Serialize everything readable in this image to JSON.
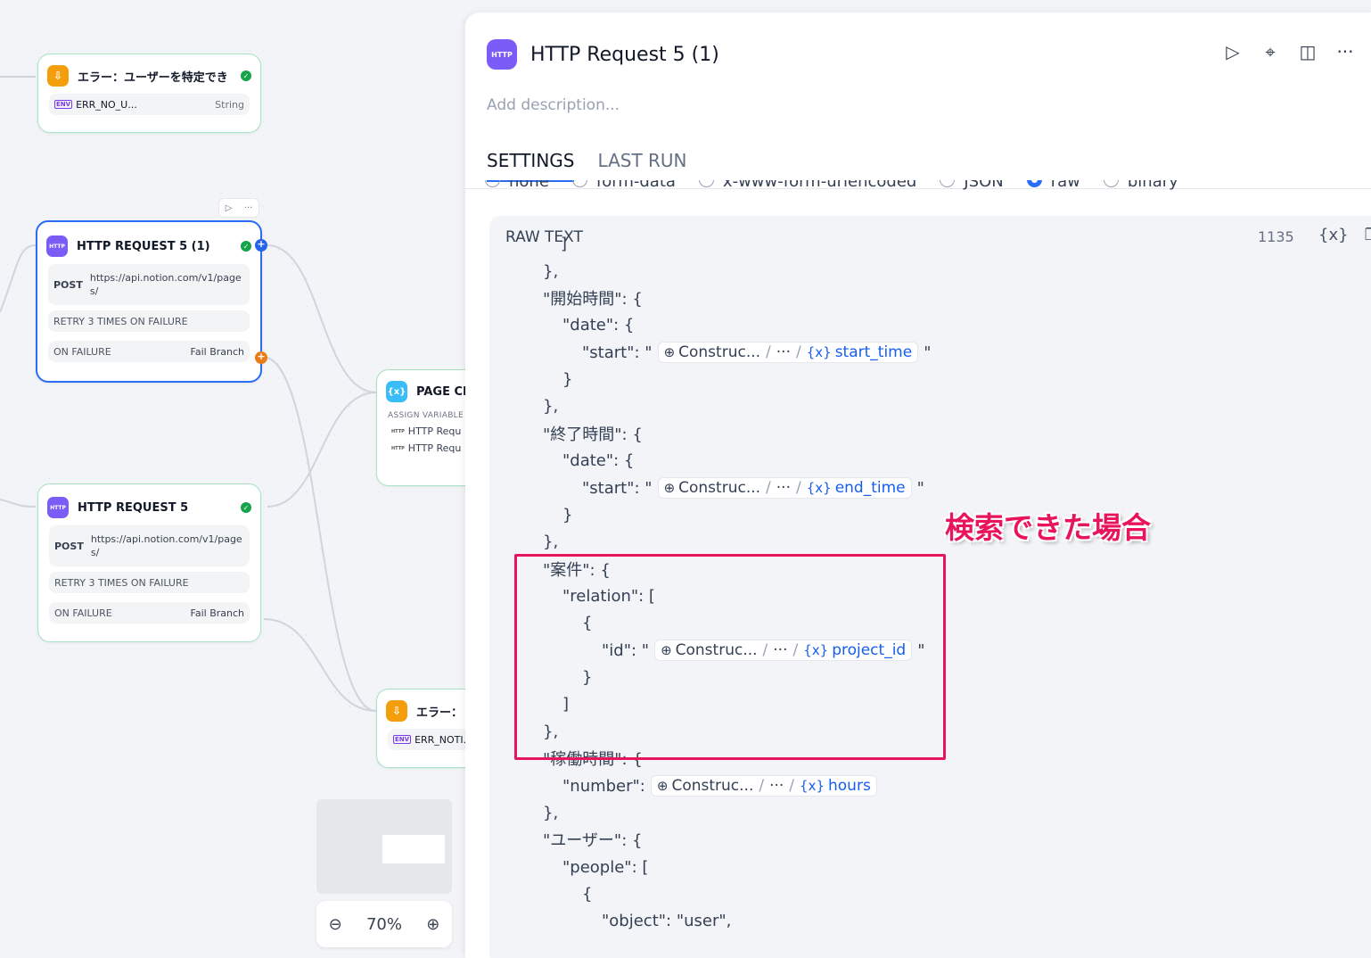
{
  "canvas": {
    "nodes": {
      "error_user": {
        "title": "エラー：ユーザーを特定でき",
        "env_label": "ENV",
        "var_name": "ERR_NO_U...",
        "var_type": "String"
      },
      "http5_1": {
        "icon_label": "HTTP",
        "title": "HTTP REQUEST 5 (1)",
        "method": "POST",
        "url": "https://api.notion.com/v1/pages/",
        "retry": "RETRY 3 TIMES ON FAILURE",
        "on_failure": "ON FAILURE",
        "fail_branch": "Fail Branch"
      },
      "page_cr": {
        "icon_label": "{x}",
        "title": "PAGE CR",
        "assign_label": "ASSIGN VARIABLE",
        "vars": [
          "HTTP Requ",
          "HTTP Requ"
        ]
      },
      "http5": {
        "icon_label": "HTTP",
        "title": "HTTP REQUEST 5",
        "method": "POST",
        "url": "https://api.notion.com/v1/pages/",
        "retry": "RETRY 3 TIMES ON FAILURE",
        "on_failure": "ON FAILURE",
        "fail_branch": "Fail Branch"
      },
      "error_noti": {
        "title": "エラー：",
        "env_label": "ENV",
        "var_name": "ERR_NOTI..."
      }
    },
    "zoom": {
      "level": "70%"
    }
  },
  "panel": {
    "icon_label": "HTTP",
    "title": "HTTP Request 5 (1)",
    "description_placeholder": "Add description...",
    "tabs": [
      {
        "label": "SETTINGS",
        "active": true
      },
      {
        "label": "LAST RUN",
        "active": false
      }
    ],
    "body_types": [
      {
        "label": "none",
        "selected": false
      },
      {
        "label": "form-data",
        "selected": false
      },
      {
        "label": "x-www-form-urlencoded",
        "selected": false
      },
      {
        "label": "JSON",
        "selected": false
      },
      {
        "label": "raw",
        "selected": true
      },
      {
        "label": "binary",
        "selected": false
      }
    ],
    "editor": {
      "label": "RAW TEXT",
      "char_count": "1135",
      "var_button": "{x}",
      "lines": {
        "l00": "]",
        "l01": "},",
        "l02": "\"開始時間\": {",
        "l03": "\"date\": {",
        "l04": "\"start\": \"",
        "l05": "}",
        "l06": "},",
        "l07": "\"終了時間\": {",
        "l08": "\"date\": {",
        "l09": "\"start\": \"",
        "l10": "}",
        "l11": "},",
        "l12": "\"案件\": {",
        "l13": "\"relation\": [",
        "l14": "{",
        "l15": "\"id\": \"",
        "l16": "}",
        "l17": "]",
        "l18": "},",
        "l19": "\"稼働時間\": {",
        "l20": "\"number\":",
        "l21": "},",
        "l22": "\"ユーザー\": {",
        "l23": "\"people\": [",
        "l24": "{",
        "l25": "\"object\": \"user\","
      },
      "close_quote": "\"",
      "chips": {
        "c1": {
          "node": "Construc...",
          "more": "···",
          "var": "start_time"
        },
        "c2": {
          "node": "Construc...",
          "more": "···",
          "var": "end_time"
        },
        "c3": {
          "node": "Construc...",
          "more": "···",
          "var": "project_id"
        },
        "c4": {
          "node": "Construc...",
          "more": "···",
          "var": "hours"
        }
      },
      "var_prefix": "{x}"
    }
  },
  "annotation": {
    "text": "検索できた場合",
    "color": "#e8145c"
  },
  "colors": {
    "accent": "#2a6cf6",
    "http_icon": "#7c5cf6",
    "success": "#16a34a",
    "fail": "#ea7c18"
  }
}
